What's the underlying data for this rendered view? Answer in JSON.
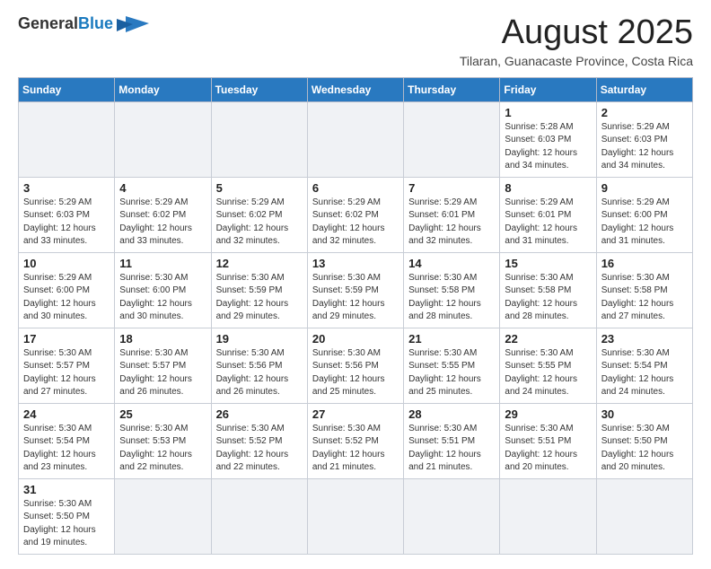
{
  "header": {
    "logo_line1": "General",
    "logo_line2": "Blue",
    "title": "August 2025",
    "subtitle": "Tilaran, Guanacaste Province, Costa Rica"
  },
  "days_of_week": [
    "Sunday",
    "Monday",
    "Tuesday",
    "Wednesday",
    "Thursday",
    "Friday",
    "Saturday"
  ],
  "weeks": [
    [
      {
        "day": "",
        "info": ""
      },
      {
        "day": "",
        "info": ""
      },
      {
        "day": "",
        "info": ""
      },
      {
        "day": "",
        "info": ""
      },
      {
        "day": "",
        "info": ""
      },
      {
        "day": "1",
        "info": "Sunrise: 5:28 AM\nSunset: 6:03 PM\nDaylight: 12 hours\nand 34 minutes."
      },
      {
        "day": "2",
        "info": "Sunrise: 5:29 AM\nSunset: 6:03 PM\nDaylight: 12 hours\nand 34 minutes."
      }
    ],
    [
      {
        "day": "3",
        "info": "Sunrise: 5:29 AM\nSunset: 6:03 PM\nDaylight: 12 hours\nand 33 minutes."
      },
      {
        "day": "4",
        "info": "Sunrise: 5:29 AM\nSunset: 6:02 PM\nDaylight: 12 hours\nand 33 minutes."
      },
      {
        "day": "5",
        "info": "Sunrise: 5:29 AM\nSunset: 6:02 PM\nDaylight: 12 hours\nand 32 minutes."
      },
      {
        "day": "6",
        "info": "Sunrise: 5:29 AM\nSunset: 6:02 PM\nDaylight: 12 hours\nand 32 minutes."
      },
      {
        "day": "7",
        "info": "Sunrise: 5:29 AM\nSunset: 6:01 PM\nDaylight: 12 hours\nand 32 minutes."
      },
      {
        "day": "8",
        "info": "Sunrise: 5:29 AM\nSunset: 6:01 PM\nDaylight: 12 hours\nand 31 minutes."
      },
      {
        "day": "9",
        "info": "Sunrise: 5:29 AM\nSunset: 6:00 PM\nDaylight: 12 hours\nand 31 minutes."
      }
    ],
    [
      {
        "day": "10",
        "info": "Sunrise: 5:29 AM\nSunset: 6:00 PM\nDaylight: 12 hours\nand 30 minutes."
      },
      {
        "day": "11",
        "info": "Sunrise: 5:30 AM\nSunset: 6:00 PM\nDaylight: 12 hours\nand 30 minutes."
      },
      {
        "day": "12",
        "info": "Sunrise: 5:30 AM\nSunset: 5:59 PM\nDaylight: 12 hours\nand 29 minutes."
      },
      {
        "day": "13",
        "info": "Sunrise: 5:30 AM\nSunset: 5:59 PM\nDaylight: 12 hours\nand 29 minutes."
      },
      {
        "day": "14",
        "info": "Sunrise: 5:30 AM\nSunset: 5:58 PM\nDaylight: 12 hours\nand 28 minutes."
      },
      {
        "day": "15",
        "info": "Sunrise: 5:30 AM\nSunset: 5:58 PM\nDaylight: 12 hours\nand 28 minutes."
      },
      {
        "day": "16",
        "info": "Sunrise: 5:30 AM\nSunset: 5:58 PM\nDaylight: 12 hours\nand 27 minutes."
      }
    ],
    [
      {
        "day": "17",
        "info": "Sunrise: 5:30 AM\nSunset: 5:57 PM\nDaylight: 12 hours\nand 27 minutes."
      },
      {
        "day": "18",
        "info": "Sunrise: 5:30 AM\nSunset: 5:57 PM\nDaylight: 12 hours\nand 26 minutes."
      },
      {
        "day": "19",
        "info": "Sunrise: 5:30 AM\nSunset: 5:56 PM\nDaylight: 12 hours\nand 26 minutes."
      },
      {
        "day": "20",
        "info": "Sunrise: 5:30 AM\nSunset: 5:56 PM\nDaylight: 12 hours\nand 25 minutes."
      },
      {
        "day": "21",
        "info": "Sunrise: 5:30 AM\nSunset: 5:55 PM\nDaylight: 12 hours\nand 25 minutes."
      },
      {
        "day": "22",
        "info": "Sunrise: 5:30 AM\nSunset: 5:55 PM\nDaylight: 12 hours\nand 24 minutes."
      },
      {
        "day": "23",
        "info": "Sunrise: 5:30 AM\nSunset: 5:54 PM\nDaylight: 12 hours\nand 24 minutes."
      }
    ],
    [
      {
        "day": "24",
        "info": "Sunrise: 5:30 AM\nSunset: 5:54 PM\nDaylight: 12 hours\nand 23 minutes."
      },
      {
        "day": "25",
        "info": "Sunrise: 5:30 AM\nSunset: 5:53 PM\nDaylight: 12 hours\nand 22 minutes."
      },
      {
        "day": "26",
        "info": "Sunrise: 5:30 AM\nSunset: 5:52 PM\nDaylight: 12 hours\nand 22 minutes."
      },
      {
        "day": "27",
        "info": "Sunrise: 5:30 AM\nSunset: 5:52 PM\nDaylight: 12 hours\nand 21 minutes."
      },
      {
        "day": "28",
        "info": "Sunrise: 5:30 AM\nSunset: 5:51 PM\nDaylight: 12 hours\nand 21 minutes."
      },
      {
        "day": "29",
        "info": "Sunrise: 5:30 AM\nSunset: 5:51 PM\nDaylight: 12 hours\nand 20 minutes."
      },
      {
        "day": "30",
        "info": "Sunrise: 5:30 AM\nSunset: 5:50 PM\nDaylight: 12 hours\nand 20 minutes."
      }
    ],
    [
      {
        "day": "31",
        "info": "Sunrise: 5:30 AM\nSunset: 5:50 PM\nDaylight: 12 hours\nand 19 minutes."
      },
      {
        "day": "",
        "info": ""
      },
      {
        "day": "",
        "info": ""
      },
      {
        "day": "",
        "info": ""
      },
      {
        "day": "",
        "info": ""
      },
      {
        "day": "",
        "info": ""
      },
      {
        "day": "",
        "info": ""
      }
    ]
  ]
}
